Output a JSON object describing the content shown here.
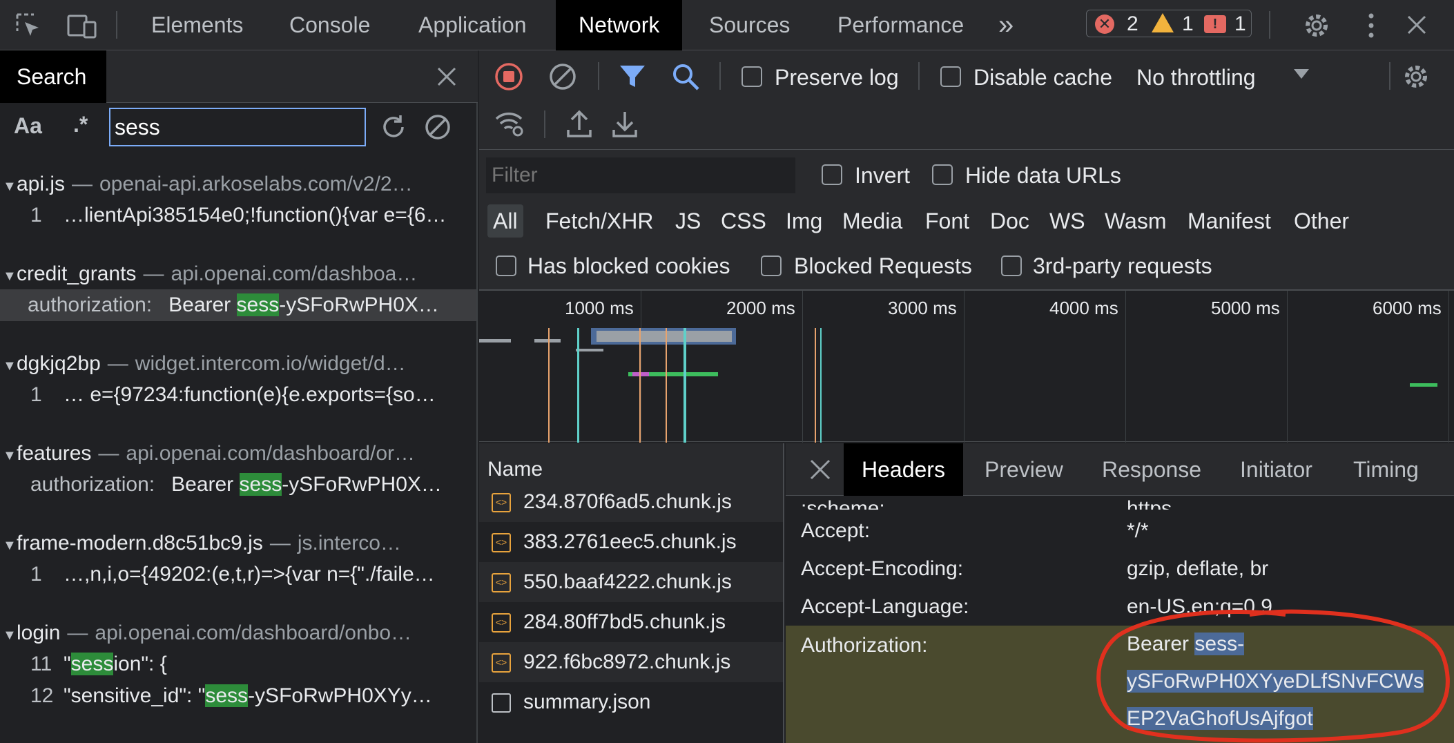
{
  "topbar": {
    "tabs": [
      "Elements",
      "Console",
      "Application",
      "Network",
      "Sources",
      "Performance"
    ],
    "more": "»",
    "errors": "2",
    "warnings": "1",
    "issues": "1"
  },
  "search": {
    "tab_label": "Search",
    "case_label": "Aa",
    "regex_label": ".*",
    "query": "sess",
    "results": [
      {
        "file": "api.js",
        "url": "openai-api.arkoselabs.com/v2/2…",
        "lines": [
          {
            "num": "1",
            "pre": "…lientApi385154e0;!function(){var e={6…",
            "match": "",
            "post": ""
          }
        ]
      },
      {
        "file": "credit_grants",
        "url": "api.openai.com/dashboa…",
        "lines": [
          {
            "key": "authorization:",
            "pre": "Bearer ",
            "match": "sess",
            "post": "-ySFoRwPH0X…",
            "selected": true
          }
        ]
      },
      {
        "file": "dgkjq2bp",
        "url": "widget.intercom.io/widget/d…",
        "lines": [
          {
            "num": "1",
            "pre": "… e={97234:function(e){e.exports={so…",
            "match": "",
            "post": ""
          }
        ]
      },
      {
        "file": "features",
        "url": "api.openai.com/dashboard/or…",
        "lines": [
          {
            "key": "authorization:",
            "pre": "Bearer ",
            "match": "sess",
            "post": "-ySFoRwPH0X…"
          }
        ]
      },
      {
        "file": "frame-modern.d8c51bc9.js",
        "url": "js.interco…",
        "lines": [
          {
            "num": "1",
            "pre": "…,n,i,o={49202:(e,t,r)=>{var n={\"./faile…",
            "match": "",
            "post": ""
          }
        ]
      },
      {
        "file": "login",
        "url": "api.openai.com/dashboard/onbo…",
        "lines": [
          {
            "num": "11",
            "pre": "\"",
            "match": "sess",
            "post": "ion\": {"
          },
          {
            "num": "12",
            "pre": "\"sensitive_id\": \"",
            "match": "sess",
            "post": "-ySFoRwPH0XYy…"
          }
        ]
      }
    ]
  },
  "network": {
    "preserve_log": "Preserve log",
    "disable_cache": "Disable cache",
    "throttling": "No throttling",
    "filter_placeholder": "Filter",
    "invert": "Invert",
    "hide_data_urls": "Hide data URLs",
    "types": [
      "All",
      "Fetch/XHR",
      "JS",
      "CSS",
      "Img",
      "Media",
      "Font",
      "Doc",
      "WS",
      "Wasm",
      "Manifest",
      "Other"
    ],
    "has_blocked_cookies": "Has blocked cookies",
    "blocked_requests": "Blocked Requests",
    "third_party": "3rd-party requests",
    "timeline_ticks": [
      "1000 ms",
      "2000 ms",
      "3000 ms",
      "4000 ms",
      "5000 ms",
      "6000 ms"
    ],
    "name_header": "Name",
    "files": [
      {
        "name": "234.870f6ad5.chunk.js",
        "type": "script"
      },
      {
        "name": "383.2761eec5.chunk.js",
        "type": "script"
      },
      {
        "name": "550.baaf4222.chunk.js",
        "type": "script"
      },
      {
        "name": "284.80ff7bd5.chunk.js",
        "type": "script"
      },
      {
        "name": "922.f6bc8972.chunk.js",
        "type": "script"
      },
      {
        "name": "summary.json",
        "type": "plain"
      }
    ],
    "detail_tabs": [
      "Headers",
      "Preview",
      "Response",
      "Initiator",
      "Timing"
    ],
    "headers": [
      {
        "name": ":scheme:",
        "value": "https"
      },
      {
        "name": "Accept:",
        "value": "*/*"
      },
      {
        "name": "Accept-Encoding:",
        "value": "gzip, deflate, br"
      },
      {
        "name": "Accept-Language:",
        "value": "en-US,en;q=0.9"
      }
    ],
    "auth": {
      "name": "Authorization:",
      "value_pre": "Bearer ",
      "value_l1": "sess-",
      "value_l2": "ySFoRwPH0XYyeDLfSNvFCWs",
      "value_l3": "EP2VaGhofUsAjfgot"
    }
  },
  "colors": {
    "highlight": "#2d8c3a",
    "annotation": "#e0301e",
    "accent": "#7cacf8"
  }
}
